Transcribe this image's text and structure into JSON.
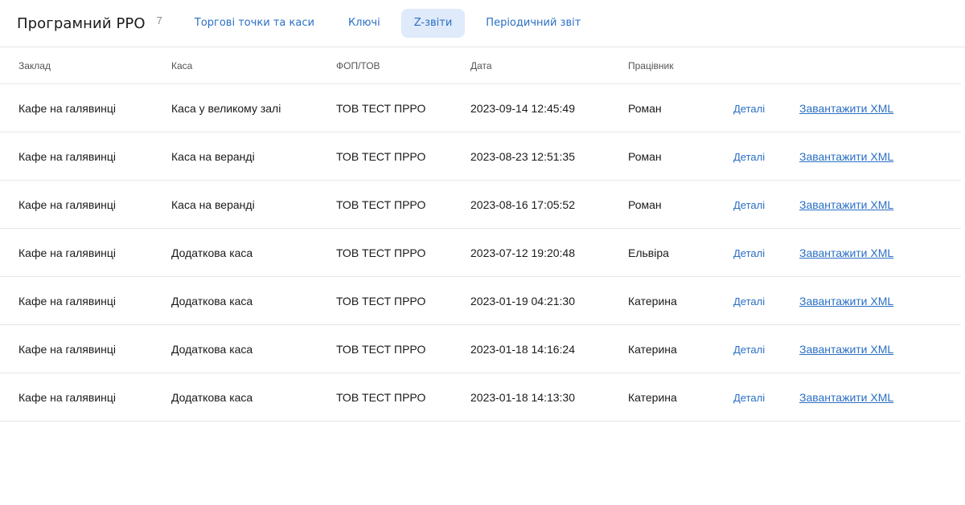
{
  "header": {
    "title": "Програмний РРО",
    "count": "7",
    "tabs": [
      {
        "label": "Торгові точки та каси",
        "active": false
      },
      {
        "label": "Ключі",
        "active": false
      },
      {
        "label": "Z-звіти",
        "active": true
      },
      {
        "label": "Періодичний звіт",
        "active": false
      }
    ]
  },
  "table": {
    "columns": [
      "Заклад",
      "Каса",
      "ФОП/ТОВ",
      "Дата",
      "Працівник"
    ],
    "details_label": "Деталі",
    "download_label": "Завантажити XML",
    "rows": [
      {
        "venue": "Кафе на галявинці",
        "register": "Каса у великому залі",
        "entity": "ТОВ ТЕСТ ПРРО",
        "date": "2023-09-14 12:45:49",
        "employee": "Роман"
      },
      {
        "venue": "Кафе на галявинці",
        "register": "Каса на веранді",
        "entity": "ТОВ ТЕСТ ПРРО",
        "date": "2023-08-23 12:51:35",
        "employee": "Роман"
      },
      {
        "venue": "Кафе на галявинці",
        "register": "Каса на веранді",
        "entity": "ТОВ ТЕСТ ПРРО",
        "date": "2023-08-16 17:05:52",
        "employee": "Роман"
      },
      {
        "venue": "Кафе на галявинці",
        "register": "Додаткова каса",
        "entity": "ТОВ ТЕСТ ПРРО",
        "date": "2023-07-12 19:20:48",
        "employee": "Ельвіра"
      },
      {
        "venue": "Кафе на галявинці",
        "register": "Додаткова каса",
        "entity": "ТОВ ТЕСТ ПРРО",
        "date": "2023-01-19 04:21:30",
        "employee": "Катерина"
      },
      {
        "venue": "Кафе на галявинці",
        "register": "Додаткова каса",
        "entity": "ТОВ ТЕСТ ПРРО",
        "date": "2023-01-18 14:16:24",
        "employee": "Катерина"
      },
      {
        "venue": "Кафе на галявинці",
        "register": "Додаткова каса",
        "entity": "ТОВ ТЕСТ ПРРО",
        "date": "2023-01-18 14:13:30",
        "employee": "Катерина"
      }
    ]
  }
}
